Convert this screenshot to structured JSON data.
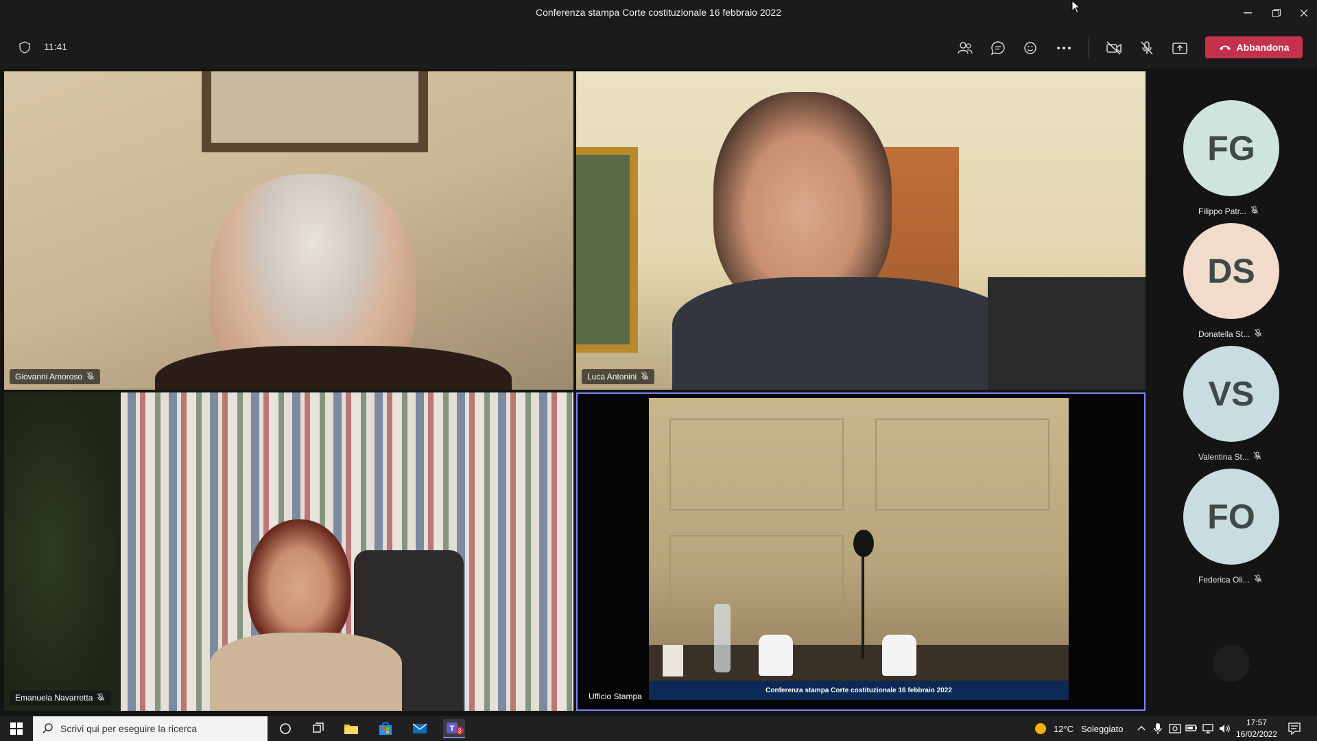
{
  "window": {
    "title": "Conferenza stampa Corte costituzionale 16 febbraio 2022",
    "controls": [
      "minimize-icon",
      "restore-icon",
      "close-icon"
    ]
  },
  "toolbar": {
    "elapsed": "11:41",
    "buttons": [
      "people-icon",
      "chat-icon",
      "reactions-icon",
      "more-icon",
      "camera-off-icon",
      "mic-off-icon",
      "share-icon"
    ],
    "leave_label": "Abbandona",
    "leave_color": "#c4314b"
  },
  "tiles": [
    {
      "name": "Giovanni Amoroso",
      "muted": true
    },
    {
      "name": "Luca Antonini",
      "muted": true
    },
    {
      "name": "Emanuela Navarretta",
      "muted": true
    },
    {
      "name": "Ufficio Stampa",
      "muted": false,
      "active_speaker": true,
      "caption": "Conferenza stampa Corte costituzionale 16 febbraio 2022"
    }
  ],
  "sidebar": {
    "participants": [
      {
        "initials": "FG",
        "name": "Filippo Patr...",
        "color": "#cfe4de",
        "muted": true
      },
      {
        "initials": "DS",
        "name": "Donatella St...",
        "color": "#f1dccc",
        "muted": true
      },
      {
        "initials": "VS",
        "name": "Valentina St...",
        "color": "#c9dcdf",
        "muted": true
      },
      {
        "initials": "FO",
        "name": "Federica Oli...",
        "color": "#c9dcdf",
        "muted": true
      }
    ]
  },
  "taskbar": {
    "search_placeholder": "Scrivi qui per eseguire la ricerca",
    "teams_badge": "3",
    "weather_temp": "12°C",
    "weather_desc": "Soleggiato",
    "time": "17:57",
    "date": "16/02/2022"
  }
}
